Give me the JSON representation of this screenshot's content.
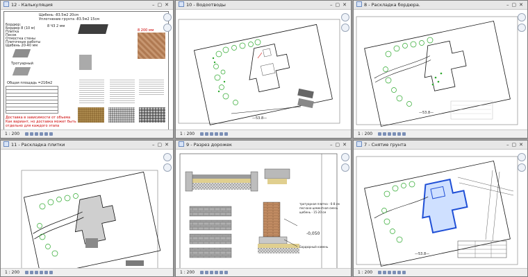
{
  "views": [
    {
      "title": "12 - Калькуляция",
      "scale": "1 : 200"
    },
    {
      "title": "10 - Водоотводы",
      "scale": "1 : 200"
    },
    {
      "title": "8 - Раскладка бордюра.",
      "scale": "1 : 200"
    },
    {
      "title": "11 - Раскладка плитки",
      "scale": "1 : 200"
    },
    {
      "title": "9 - Разрез дорожек",
      "scale": "1 : 200"
    },
    {
      "title": "7 - Снятие грунта",
      "scale": "1 : 200"
    }
  ],
  "calc": {
    "row1": "Щебень        -83.5м2        20см",
    "row2": "Уплотнение грунта       -83.5м2        15см",
    "list": [
      "Бордюр:",
      "Бордюр 8 (10 м)",
      "Плитка",
      "Песок",
      "Отмостка стены",
      "Плиточные работы",
      "Щебень 20-40 мм"
    ],
    "note_left": "Тротуарный",
    "dims": "8 Ч3 2 мм",
    "red_lines": [
      "Доставка в зависимости от объема",
      "Как вариант, но доставка может быть",
      "отдельно для каждого этапа"
    ],
    "table_title": "Общая площадь =216м2"
  },
  "drain": {
    "dim": "—53.8—"
  },
  "curb": {
    "dim": "—53.8—"
  },
  "section": {
    "value": "-0,050",
    "notes": [
      "тротуарная плитка - 6-8 см",
      "песчано-цементная смесь",
      "щебень - 15-20 см",
      "Бордюрный камень"
    ]
  },
  "soil": {
    "dim": "—53.8—"
  }
}
